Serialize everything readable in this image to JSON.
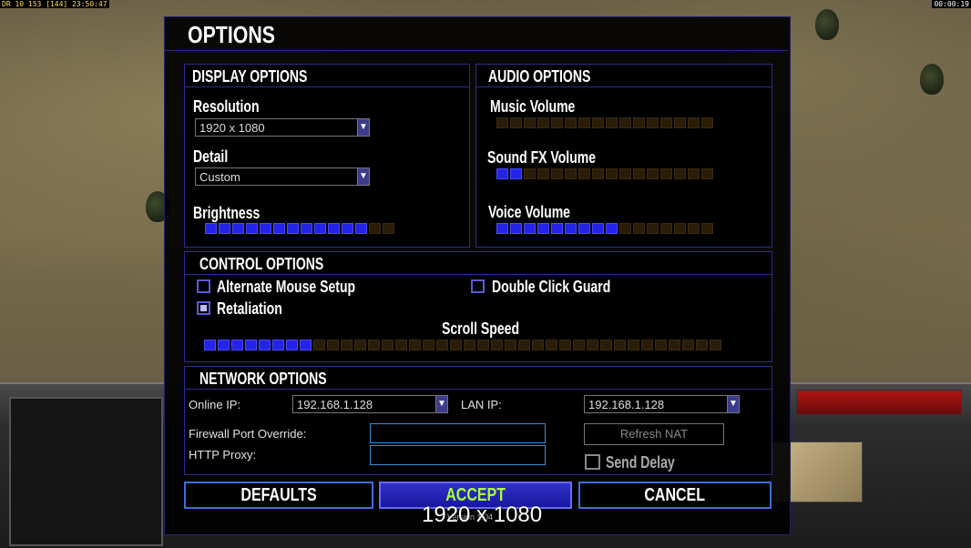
{
  "status_bar": {
    "left_text": "DR 10 153 [144] 23:50:47",
    "right_text": "00:00:19"
  },
  "dialog": {
    "title": "OPTIONS",
    "display": {
      "title": "DISPLAY OPTIONS",
      "resolution_label": "Resolution",
      "resolution_value": "1920 x 1080",
      "detail_label": "Detail",
      "detail_value": "Custom",
      "brightness_label": "Brightness",
      "brightness_level": 12,
      "brightness_max": 14
    },
    "audio": {
      "title": "AUDIO OPTIONS",
      "music_label": "Music Volume",
      "music_level": 0,
      "music_max": 16,
      "sfx_label": "Sound FX Volume",
      "sfx_level": 2,
      "sfx_max": 16,
      "voice_label": "Voice Volume",
      "voice_level": 9,
      "voice_max": 16
    },
    "control": {
      "title": "CONTROL OPTIONS",
      "alt_mouse_label": "Alternate Mouse Setup",
      "alt_mouse_checked": false,
      "double_click_label": "Double Click Guard",
      "double_click_checked": false,
      "retaliation_label": "Retaliation",
      "retaliation_checked": true,
      "scroll_speed_label": "Scroll Speed",
      "scroll_level": 8,
      "scroll_max": 38
    },
    "network": {
      "title": "NETWORK OPTIONS",
      "online_ip_label": "Online IP:",
      "online_ip_value": "192.168.1.128",
      "lan_ip_label": "LAN IP:",
      "lan_ip_value": "192.168.1.128",
      "firewall_label": "Firewall Port Override:",
      "firewall_value": "",
      "proxy_label": "HTTP Proxy:",
      "proxy_value": "",
      "refresh_nat_label": "Refresh NAT",
      "send_delay_label": "Send Delay",
      "send_delay_checked": false
    },
    "buttons": {
      "defaults": "DEFAULTS",
      "accept": "ACCEPT",
      "cancel": "CANCEL"
    },
    "version_text": "Version 1.04"
  },
  "resolution_overlay": "1920 x 1080",
  "colors": {
    "slider_on": "#2424e8",
    "slider_off": "#2a1d08",
    "accent_border": "#3d6fd6",
    "accept_text": "#a8ff3a"
  }
}
